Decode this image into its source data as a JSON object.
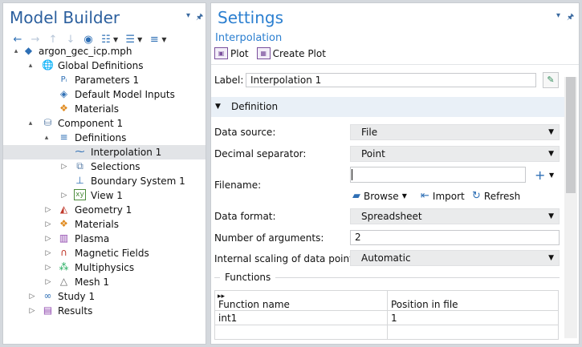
{
  "model_builder": {
    "title": "Model Builder",
    "tree": [
      {
        "label": "argon_gec_icp.mph",
        "icon": "model-icon",
        "expander": "▴"
      },
      {
        "label": "Global Definitions",
        "icon": "globe-icon",
        "expander": "▴"
      },
      {
        "label": "Parameters 1",
        "icon": "parameters-icon",
        "expander": ""
      },
      {
        "label": "Default Model Inputs",
        "icon": "model-inputs-icon",
        "expander": ""
      },
      {
        "label": "Materials",
        "icon": "materials-icon",
        "expander": ""
      },
      {
        "label": "Component 1",
        "icon": "component-icon",
        "expander": "▴"
      },
      {
        "label": "Definitions",
        "icon": "definitions-icon",
        "expander": "▴"
      },
      {
        "label": "Interpolation 1",
        "icon": "interpolation-icon",
        "expander": ""
      },
      {
        "label": "Selections",
        "icon": "selections-icon",
        "expander": "▷"
      },
      {
        "label": "Boundary System 1",
        "icon": "boundary-system-icon",
        "expander": ""
      },
      {
        "label": "View 1",
        "icon": "view-icon",
        "expander": "▷"
      },
      {
        "label": "Geometry 1",
        "icon": "geometry-icon",
        "expander": "▷"
      },
      {
        "label": "Materials",
        "icon": "materials-icon",
        "expander": "▷"
      },
      {
        "label": "Plasma",
        "icon": "plasma-icon",
        "expander": "▷"
      },
      {
        "label": "Magnetic Fields",
        "icon": "magnetic-fields-icon",
        "expander": "▷"
      },
      {
        "label": "Multiphysics",
        "icon": "multiphysics-icon",
        "expander": "▷"
      },
      {
        "label": "Mesh 1",
        "icon": "mesh-icon",
        "expander": "▷"
      },
      {
        "label": "Study 1",
        "icon": "study-icon",
        "expander": "▷"
      },
      {
        "label": "Results",
        "icon": "results-icon",
        "expander": "▷"
      }
    ]
  },
  "settings": {
    "title": "Settings",
    "subtitle": "Interpolation",
    "plot_label": "Plot",
    "create_plot_label": "Create Plot",
    "label_caption": "Label:",
    "label_value": "Interpolation 1",
    "section_title": "Definition",
    "data_source_label": "Data source:",
    "data_source_value": "File",
    "decimal_separator_label": "Decimal separator:",
    "decimal_separator_value": "Point",
    "filename_label": "Filename:",
    "filename_value": "",
    "browse_label": "Browse",
    "import_label": "Import",
    "refresh_label": "Refresh",
    "data_format_label": "Data format:",
    "data_format_value": "Spreadsheet",
    "num_args_label": "Number of arguments:",
    "num_args_value": "2",
    "scaling_label": "Internal scaling of data points:",
    "scaling_value": "Automatic",
    "functions_label": "Functions",
    "table": {
      "headers": [
        "Function name",
        "Position in file"
      ],
      "rows": [
        [
          "int1",
          "1"
        ]
      ]
    }
  }
}
